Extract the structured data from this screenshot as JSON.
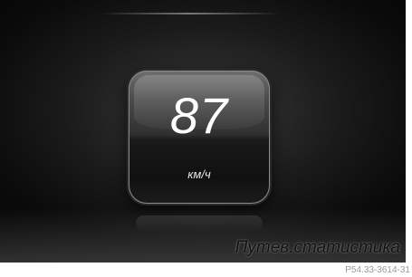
{
  "display": {
    "speed_value": "87",
    "speed_unit": "км/ч",
    "title": "Путев.статистика"
  },
  "figure": {
    "reference": "P54.33-3614-31"
  },
  "colors": {
    "background": "#0b0b0b",
    "text": "#ffffff"
  }
}
